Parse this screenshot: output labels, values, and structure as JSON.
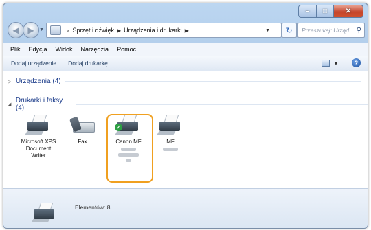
{
  "titlebar": {
    "buttons": {
      "minimize": "–",
      "maximize": "□",
      "close": "✕"
    }
  },
  "nav": {
    "breadcrumb": [
      "Sprzęt i dźwięk",
      "Urządzenia i drukarki"
    ],
    "breadcrumb_prefix": "«",
    "search_placeholder": "Przeszukaj: Urząd..."
  },
  "menu": [
    "Plik",
    "Edycja",
    "Widok",
    "Narzędzia",
    "Pomoc"
  ],
  "toolbar": {
    "add_device": "Dodaj urządzenie",
    "add_printer": "Dodaj drukarkę"
  },
  "groups": {
    "devices": {
      "label": "Urządzenia (4)",
      "expanded": false
    },
    "printers": {
      "label": "Drukarki i faksy (4)",
      "expanded": true
    }
  },
  "printers": [
    {
      "name": "Microsoft XPS Document Writer",
      "icon": "printer-icon"
    },
    {
      "name": "Fax",
      "icon": "fax-icon"
    },
    {
      "name": "Canon MF",
      "icon": "printer-icon",
      "default": true,
      "selected": true
    },
    {
      "name": "MF",
      "icon": "printer-icon"
    }
  ],
  "details": {
    "count_label": "Elementów: 8"
  },
  "colors": {
    "selection": "#f0a020",
    "default_check": "#2da044",
    "header_text": "#1e3e8c"
  }
}
